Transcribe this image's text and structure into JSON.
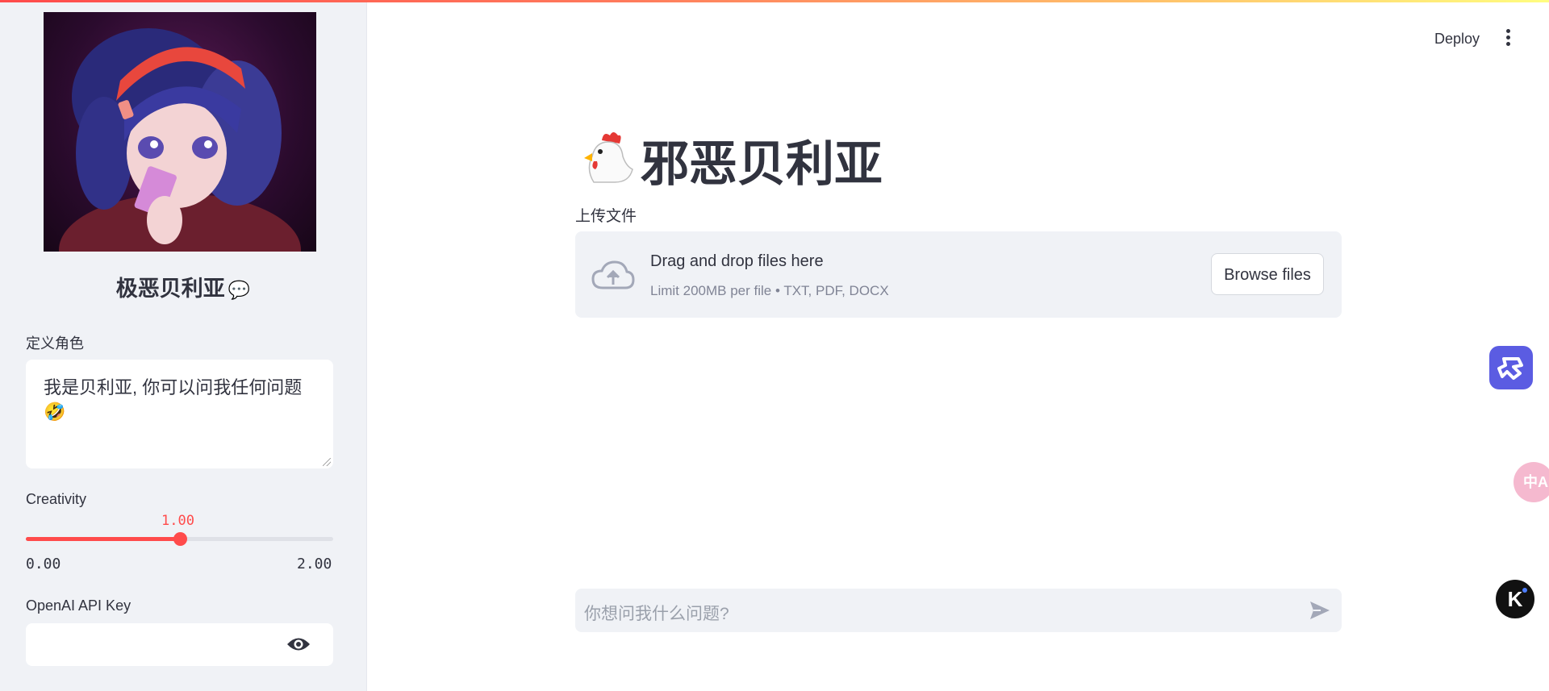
{
  "sidebar": {
    "heading": "极恶贝利亚",
    "heading_emoji": "💬",
    "role_label": "定义角色",
    "role_text": "我是贝利亚, 你可以问我任何问题",
    "role_emoji": "🤣",
    "creativity_label": "Creativity",
    "creativity_value": "1.00",
    "creativity_fraction": 0.5,
    "creativity_min": "0.00",
    "creativity_max": "2.00",
    "api_key_label": "OpenAI API Key",
    "api_key_value": ""
  },
  "header": {
    "deploy_label": "Deploy"
  },
  "main": {
    "title": "邪恶贝利亚",
    "title_icon": "rooster-icon",
    "upload_label": "上传文件",
    "drop_title": "Drag and drop files here",
    "drop_sub": "Limit 200MB per file • TXT, PDF, DOCX",
    "browse_label": "Browse files",
    "chat_placeholder": "你想问我什么问题?"
  },
  "floating": {
    "translate_label": "中A",
    "k_label": "K"
  },
  "colors": {
    "accent": "#ff4b4b",
    "sidebar_bg": "#f0f2f6",
    "text": "#31333f",
    "float_purple": "#5b5ce2"
  }
}
